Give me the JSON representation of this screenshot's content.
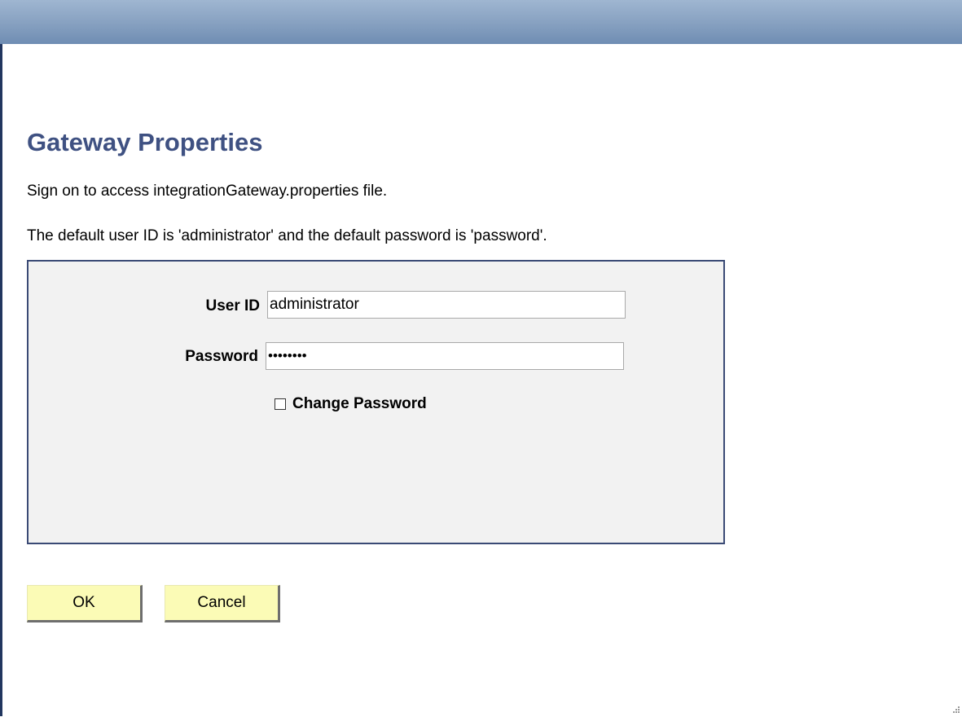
{
  "header": {
    "bar_color": "#86a0c0"
  },
  "page": {
    "title": "Gateway Properties",
    "instruction_1": "Sign on to access integrationGateway.properties file.",
    "instruction_2": "The default user ID is 'administrator' and the default password is 'password'."
  },
  "signon": {
    "user_id_label": "User ID",
    "user_id_value": "administrator",
    "password_label": "Password",
    "password_value": "••••••••",
    "change_password_label": "Change Password",
    "change_password_checked": false
  },
  "buttons": {
    "ok_label": "OK",
    "cancel_label": "Cancel"
  },
  "colors": {
    "title": "#3f5182",
    "panel_border": "#3a4a75",
    "panel_bg": "#f2f2f2",
    "button_bg": "#fbfbb6"
  }
}
